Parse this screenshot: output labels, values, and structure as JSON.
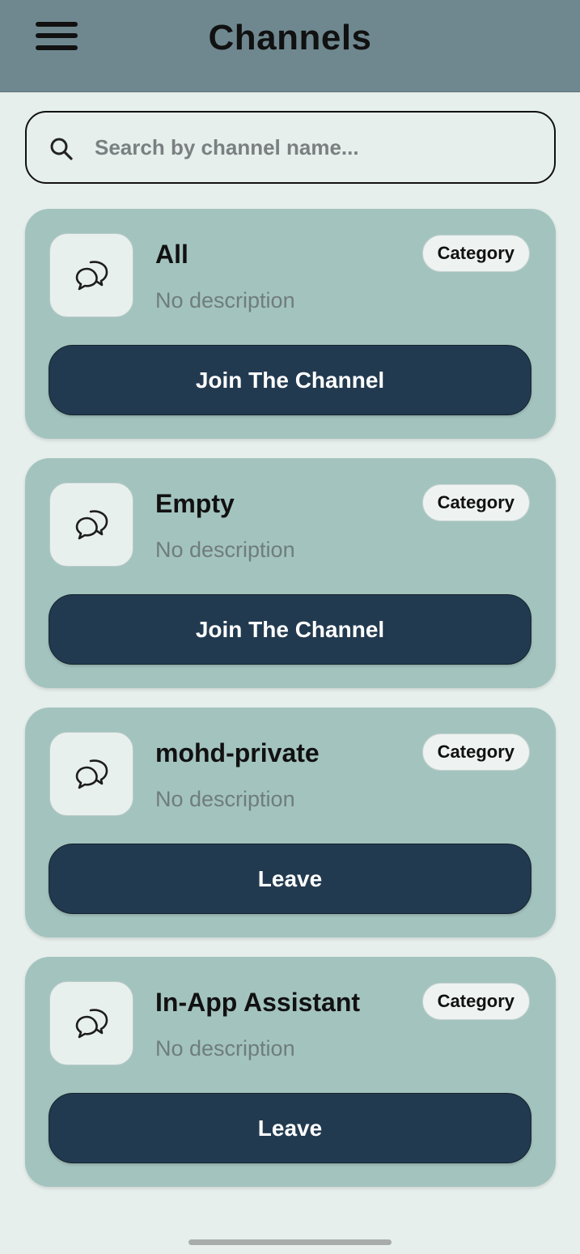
{
  "header": {
    "title": "Channels",
    "menu_icon": "hamburger-menu-icon"
  },
  "search": {
    "placeholder": "Search by channel name...",
    "value": "",
    "icon": "search-icon"
  },
  "channels": [
    {
      "name": "All",
      "description": "No description",
      "badge": "Category",
      "action": "Join The Channel",
      "icon": "chat-bubbles-icon"
    },
    {
      "name": "Empty",
      "description": "No description",
      "badge": "Category",
      "action": "Join The Channel",
      "icon": "chat-bubbles-icon"
    },
    {
      "name": "mohd-private",
      "description": "No description",
      "badge": "Category",
      "action": "Leave",
      "icon": "chat-bubbles-icon"
    },
    {
      "name": "In-App Assistant",
      "description": "No description",
      "badge": "Category",
      "action": "Leave",
      "icon": "chat-bubbles-icon"
    }
  ],
  "colors": {
    "header_bg": "#6f8890",
    "page_bg": "#e6efec",
    "card_bg": "#a3c3be",
    "button_bg": "#223a50",
    "button_text": "#ffffff"
  }
}
